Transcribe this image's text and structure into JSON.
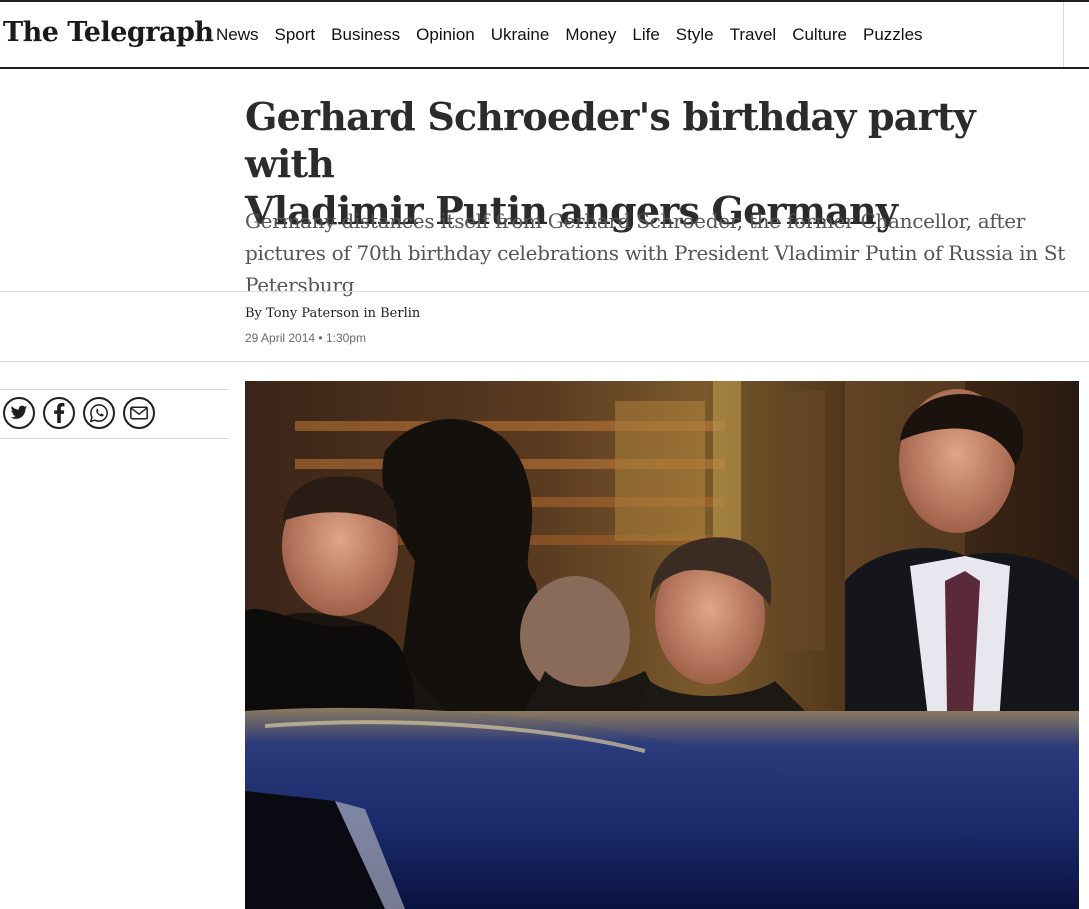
{
  "header": {
    "logo": "The Telegraph",
    "nav": [
      "News",
      "Sport",
      "Business",
      "Opinion",
      "Ukraine",
      "Money",
      "Life",
      "Style",
      "Travel",
      "Culture",
      "Puzzles"
    ]
  },
  "article": {
    "headline_line1": "Gerhard Schroeder's birthday party with",
    "headline_line2": "Vladimir Putin angers Germany",
    "standfirst": "Germany distances itself from Gerhard Schroeder, the former Chancellor, after pictures of 70th birthday celebrations with President Vladimir Putin of Russia in St Petersburg",
    "byline_prefix": "By",
    "author": "Tony Paterson",
    "location": "in Berlin",
    "date": "29 April 2014",
    "time": "1:30pm"
  },
  "share": {
    "icons": [
      "twitter-icon",
      "facebook-icon",
      "whatsapp-icon",
      "email-icon"
    ]
  },
  "colors": {
    "text": "#121212",
    "headline": "#2b2b2b",
    "standfirst": "#555555",
    "meta": "#6b6b6b",
    "rule": "#dcdcdc"
  }
}
